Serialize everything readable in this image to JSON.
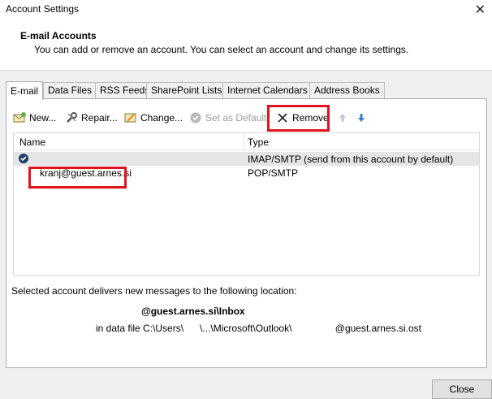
{
  "window": {
    "title": "Account Settings"
  },
  "header": {
    "title": "E-mail Accounts",
    "description": "You can add or remove an account. You can select an account and change its settings."
  },
  "tabs": [
    {
      "label": "E-mail",
      "active": true
    },
    {
      "label": "Data Files"
    },
    {
      "label": "RSS Feeds"
    },
    {
      "label": "SharePoint Lists"
    },
    {
      "label": "Internet Calendars"
    },
    {
      "label": "Address Books"
    }
  ],
  "toolbar": {
    "new_label": "New...",
    "repair_label": "Repair...",
    "change_label": "Change...",
    "set_default_label": "Set as Default",
    "remove_label": "Remove"
  },
  "accounts": {
    "col_name": "Name",
    "col_type": "Type",
    "rows": [
      {
        "name": "",
        "type": "IMAP/SMTP (send from this account by default)",
        "default": true,
        "selected": true
      },
      {
        "name": "kranj@guest.arnes.si",
        "type": "POP/SMTP"
      }
    ]
  },
  "delivery": {
    "label": "Selected account delivers new messages to the following location:",
    "folder": "@guest.arnes.si\\Inbox",
    "file_line": "in data file C:\\Users\\      \\...\\Microsoft\\Outlook\\                @guest.arnes.si.ost"
  },
  "footer": {
    "close_label": "Close"
  },
  "colors": {
    "highlight": "#e0141e",
    "selection": "#e5e5e5",
    "accent_arrow": "#3a7bd5"
  }
}
